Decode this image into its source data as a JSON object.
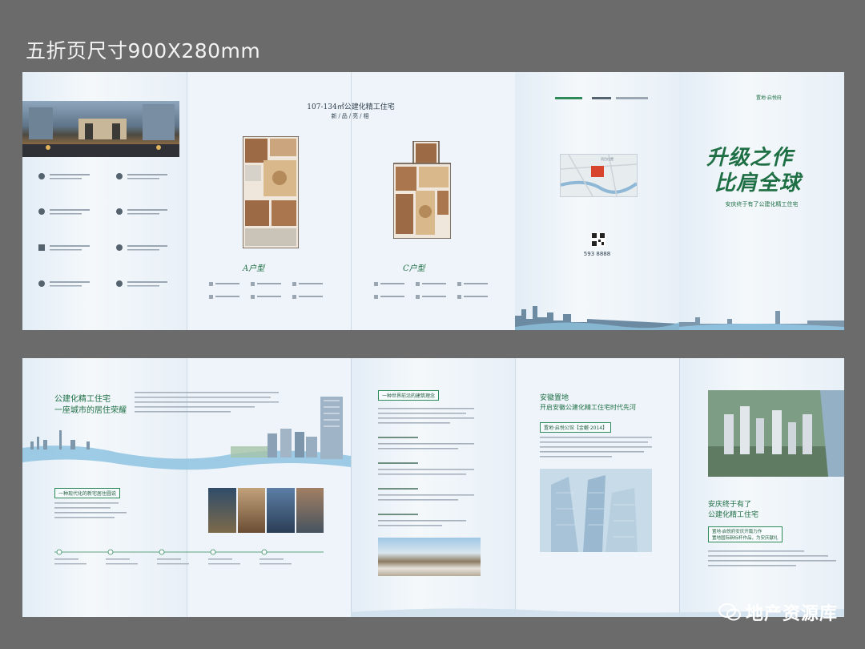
{
  "page_title": "五折页尺寸900X280mm",
  "top_sheet": {
    "floorplan_heading": "107-134㎡公建化精工住宅",
    "floorplan_sub": "新/品/亮/相",
    "unit_a_label": "A户型",
    "unit_c_label": "C户型",
    "phone": "593 8888",
    "map_label": "项目位置",
    "cover_slogan_line1": "升级之作",
    "cover_slogan_line2": "比肩全球",
    "cover_subline": "安庆终于有了公建化精工住宅",
    "cover_logo": "置地·启悦府"
  },
  "bottom_sheet": {
    "p1_title_line1": "公建化精工住宅",
    "p1_title_line2": "一座城市的居住荣耀",
    "p1_section": "一种现代化的新宅居住圆说",
    "p3_section": "一种世界前沿的建筑理念",
    "p4_title_line1": "安徽置地",
    "p4_title_line2": "开启安徽公建化精工住宅时代先河",
    "p4_badge": "置地·启悦公馆【金樾·2014】",
    "p5_title_line1": "安庆终于有了",
    "p5_title_line2": "公建化精工住宅",
    "p5_badge_line1": "置地·启悦府安庆开篇力作",
    "p5_badge_line2": "置地国际新标杆作品，为安庆献礼"
  },
  "watermark": "地产资源库",
  "colors": {
    "background": "#6b6b6b",
    "sheet": "#e9f1f8",
    "brand_green": "#1f6f45",
    "accent_green": "#2f8a5a",
    "river_blue": "#6fa8cf"
  }
}
